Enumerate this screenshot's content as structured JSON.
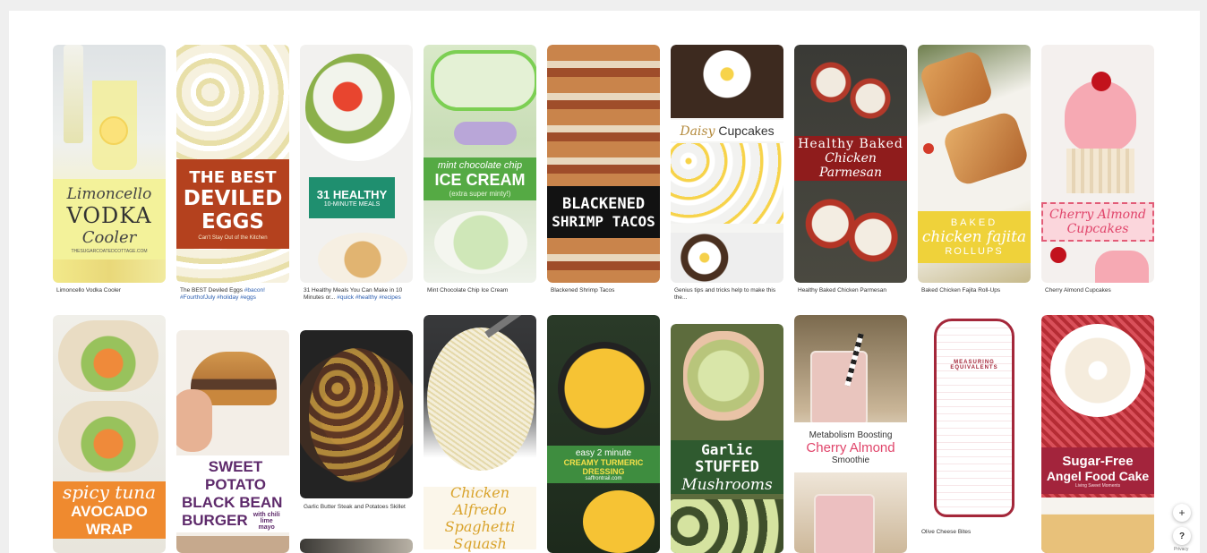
{
  "pins": [
    {
      "caption": "Limoncello Vodka Cooler",
      "overlay": [
        "Limoncello",
        "VODKA",
        "Cooler",
        "THESUGARCOATEDCOTTAGE.COM"
      ]
    },
    {
      "caption": "The BEST Deviled Eggs ",
      "tags": "#bacon! #FourthofJuly #holiday #eggs",
      "overlay": [
        "THE BEST",
        "DEVILED",
        "EGGS",
        "Can't Stay Out of the Kitchen"
      ]
    },
    {
      "caption": "31 Healthy Meals You Can Make in 10 Minutes or... ",
      "tags": "#quick #healthy #recipes",
      "overlay": [
        "31 HEALTHY",
        "10-MINUTE MEALS"
      ]
    },
    {
      "caption": "Mint Chocolate Chip Ice Cream",
      "overlay": [
        "mint chocolate chip",
        "ICE CREAM",
        "(extra super minty!)"
      ]
    },
    {
      "caption": "Blackened Shrimp Tacos",
      "overlay": [
        "BLACKENED",
        "SHRIMP TACOS"
      ]
    },
    {
      "caption": "Genius tips and tricks help to make this the...",
      "overlay": [
        "Daisy",
        "Cupcakes"
      ]
    },
    {
      "caption": "Healthy Baked Chicken Parmesan",
      "overlay": [
        "Healthy Baked",
        "Chicken Parmesan"
      ]
    },
    {
      "caption": "Baked Chicken Fajita Roll-Ups",
      "overlay": [
        "BAKED",
        "chicken fajita",
        "ROLLUPS"
      ]
    },
    {
      "caption": "Cherry Almond Cupcakes",
      "overlay": [
        "Cherry Almond",
        "Cupcakes"
      ]
    },
    {
      "caption": "",
      "overlay": [
        "spicy tuna",
        "AVOCADO WRAP"
      ]
    },
    {
      "caption": "",
      "overlay": [
        "SWEET POTATO",
        "BLACK BEAN",
        "BURGER",
        "with chili lime mayo"
      ]
    },
    {
      "caption": "Garlic Butter Steak and Potatoes Skillet",
      "overlay": []
    },
    {
      "caption": "",
      "overlay": [
        "Chicken Alfredo",
        "Spaghetti Squash"
      ]
    },
    {
      "caption": "",
      "overlay": [
        "easy 2 minute",
        "CREAMY TURMERIC DRESSING",
        "saffrontrail.com"
      ]
    },
    {
      "caption": "",
      "overlay": [
        "Garlic",
        "STUFFED",
        "Mushrooms"
      ]
    },
    {
      "caption": "",
      "overlay": [
        "Metabolism Boosting",
        "Cherry Almond",
        "Smoothie"
      ]
    },
    {
      "caption": "Olive Cheese Bites",
      "overlay": [
        "MEASURING",
        "EQUIVALENTS"
      ]
    },
    {
      "caption": "",
      "overlay": [
        "Sugar-Free",
        "Angel Food Cake",
        "Living Sweet Moments"
      ]
    }
  ],
  "controls": {
    "plus": "+",
    "help": "?",
    "privacy": "Privacy"
  },
  "colors": {
    "page_bg": "#efefef",
    "link": "#2a5db0"
  }
}
